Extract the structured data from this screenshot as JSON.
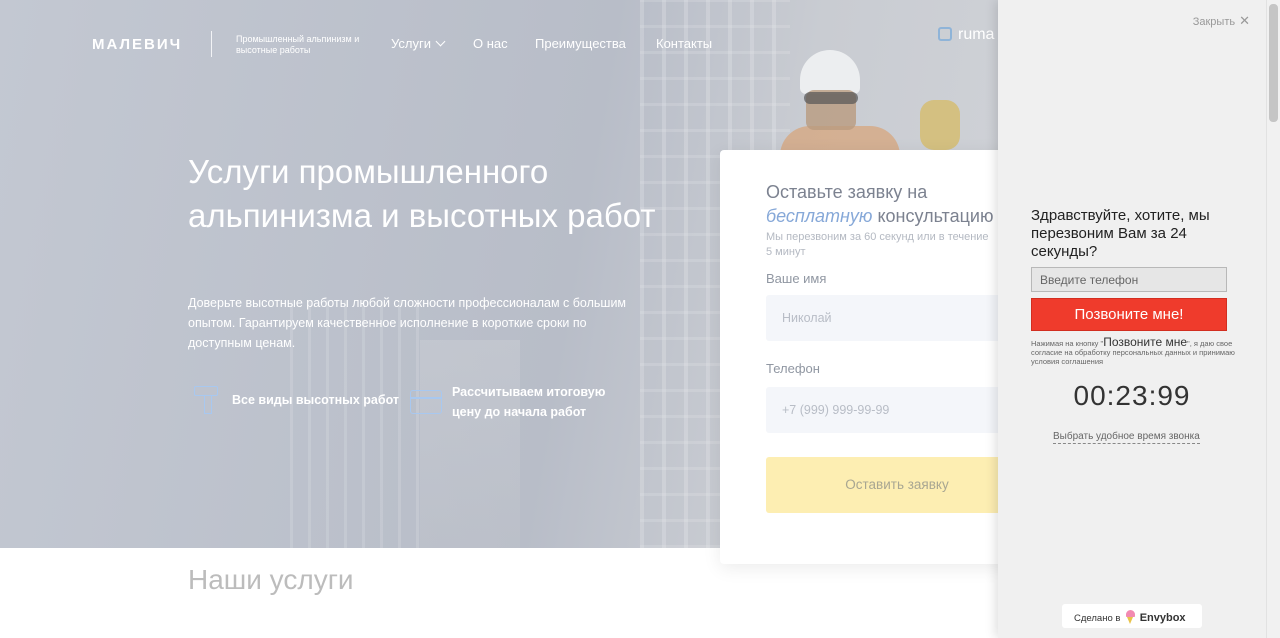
{
  "header": {
    "logo": "МАЛЕВИЧ",
    "tagline": "Промышленный альпинизм и высотные работы",
    "nav": [
      {
        "label": "Услуги"
      },
      {
        "label": "О нас"
      },
      {
        "label": "Преимущества"
      },
      {
        "label": "Контакты"
      }
    ],
    "contact_partial": "ruma",
    "contact_line2": ""
  },
  "hero": {
    "title": "Услуги промышленного альпинизма и высотных работ",
    "description": "Доверьте высотные работы любой сложности профессионалам с большим опытом. Гарантируем качественное исполнение в короткие сроки по доступным ценам.",
    "features": [
      {
        "text": "Все виды высотных работ",
        "icon": "paint-roller-icon"
      },
      {
        "text": "Рассчитываем итоговую цену до начала работ",
        "icon": "credit-card-icon"
      }
    ]
  },
  "form": {
    "title_part1": "Оставьте заявку на",
    "title_em": "бесплатную",
    "title_part2": "консультацию",
    "subtitle": "Мы перезвоним за 60 секунд или в течение 5 минут",
    "name_label": "Ваше имя",
    "name_placeholder": "Николай",
    "phone_label": "Телефон",
    "phone_placeholder": "+7 (999) 999-99-99",
    "submit": "Оставить заявку"
  },
  "services": {
    "title": "Наши услуги"
  },
  "widget": {
    "close": "Закрыть",
    "greeting": "Здравствуйте, хотите, мы перезвоним Вам за 24 секунды?",
    "phone_placeholder": "Введите телефон",
    "call_button": "Позвоните мне!",
    "consent_before": "Нажимая на кнопку \"",
    "consent_button": "Позвоните мне",
    "consent_after": "\", я даю свое согласие на обработку персональных данных и принимаю условия соглашения",
    "timer": "00:23:99",
    "schedule_link": "Выбрать удобное время звонка",
    "made_by_prefix": "Сделано в",
    "made_by_brand": "Envybox"
  },
  "colors": {
    "call_button": "#ef3b2c",
    "submit_button": "#fdeeb2",
    "accent_blue": "#86a8d8"
  }
}
